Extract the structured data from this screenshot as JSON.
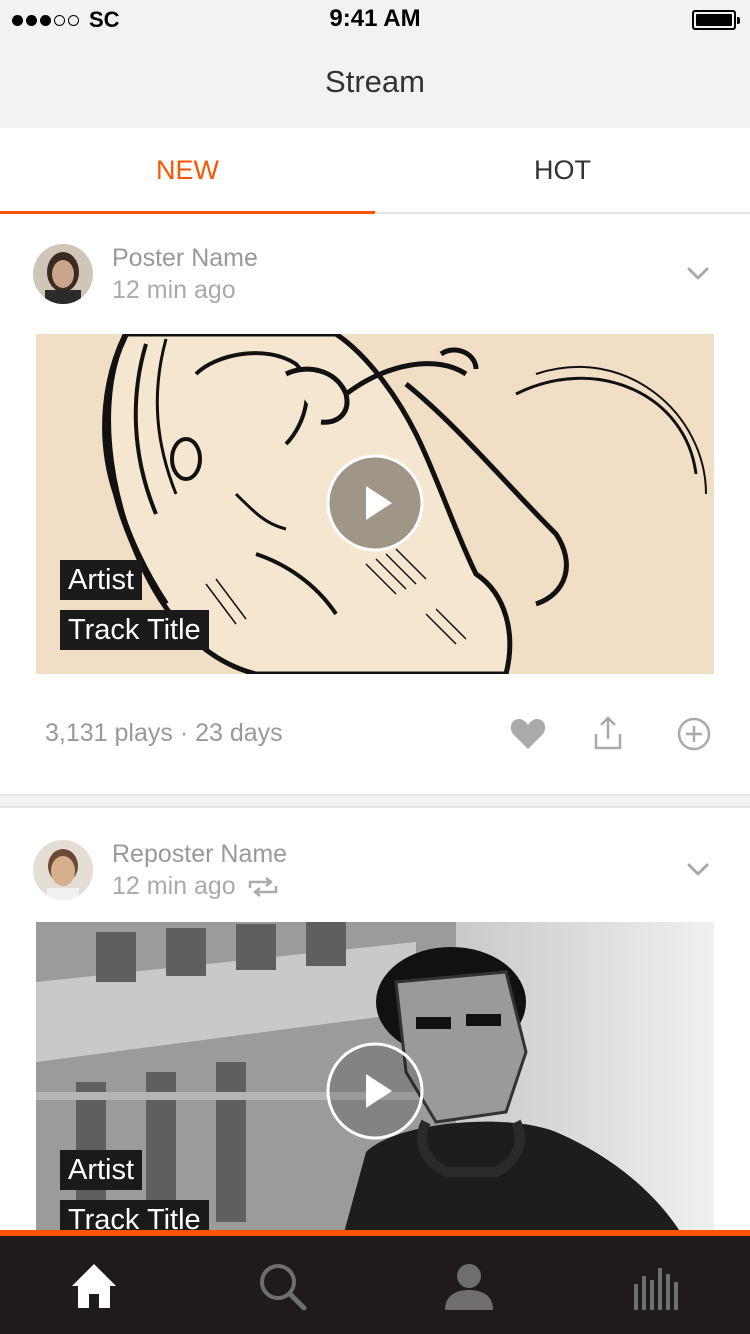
{
  "status_bar": {
    "carrier": "SC",
    "time": "9:41 AM",
    "signal_bars": 3,
    "signal_max": 5
  },
  "nav": {
    "title": "Stream"
  },
  "tabs": [
    {
      "label": "NEW",
      "active": true
    },
    {
      "label": "HOT",
      "active": false
    }
  ],
  "feed": [
    {
      "poster_name": "Poster Name",
      "time_ago": "12 min ago",
      "repost": false,
      "artist": "Artist",
      "track_title": "Track Title",
      "stats": "3,131 plays · 23 days"
    },
    {
      "poster_name": "Reposter Name",
      "time_ago": "12 min ago",
      "repost": true,
      "artist": "Artist",
      "track_title": "Track Title"
    }
  ],
  "tab_bar": {
    "items": [
      "home-icon",
      "search-icon",
      "profile-icon",
      "stats-icon"
    ],
    "active": "home-icon"
  },
  "colors": {
    "accent": "#ff5500",
    "tab_bar_bg": "#1f1b1c"
  }
}
